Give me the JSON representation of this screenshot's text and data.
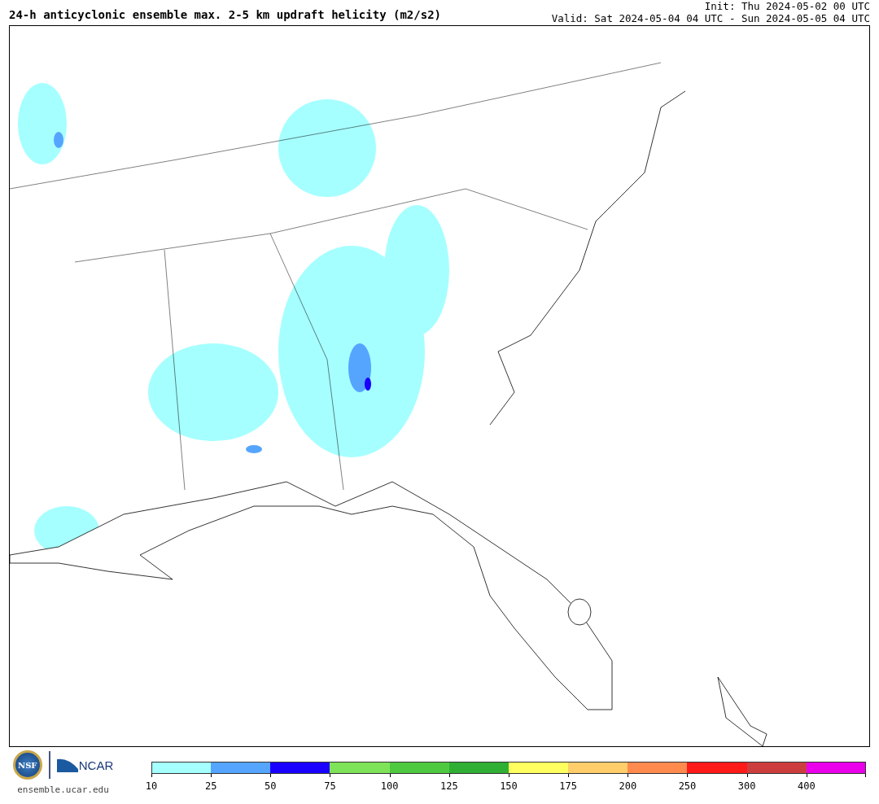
{
  "title": "24-h anticyclonic ensemble max. 2-5 km updraft helicity (m2/s2)",
  "init": "Init: Thu 2024-05-02 00 UTC",
  "valid": "Valid: Sat 2024-05-04 04 UTC - Sun 2024-05-05 04 UTC",
  "logos": {
    "nsf": "NSF",
    "ncar": "NCAR",
    "url": "ensemble.ucar.edu"
  },
  "colorbar": [
    {
      "label": "10",
      "color": "#a6ffff"
    },
    {
      "label": "25",
      "color": "#55a5ff"
    },
    {
      "label": "50",
      "color": "#1a00ff"
    },
    {
      "label": "75",
      "color": "#7fe35a"
    },
    {
      "label": "100",
      "color": "#4fca40"
    },
    {
      "label": "125",
      "color": "#2fb034"
    },
    {
      "label": "150",
      "color": "#ffff60"
    },
    {
      "label": "175",
      "color": "#ffcd6a"
    },
    {
      "label": "200",
      "color": "#ff8a4e"
    },
    {
      "label": "250",
      "color": "#ff1a1a"
    },
    {
      "label": "300",
      "color": "#cc3e3e"
    },
    {
      "label": "400",
      "color": "#ea00ea"
    }
  ]
}
